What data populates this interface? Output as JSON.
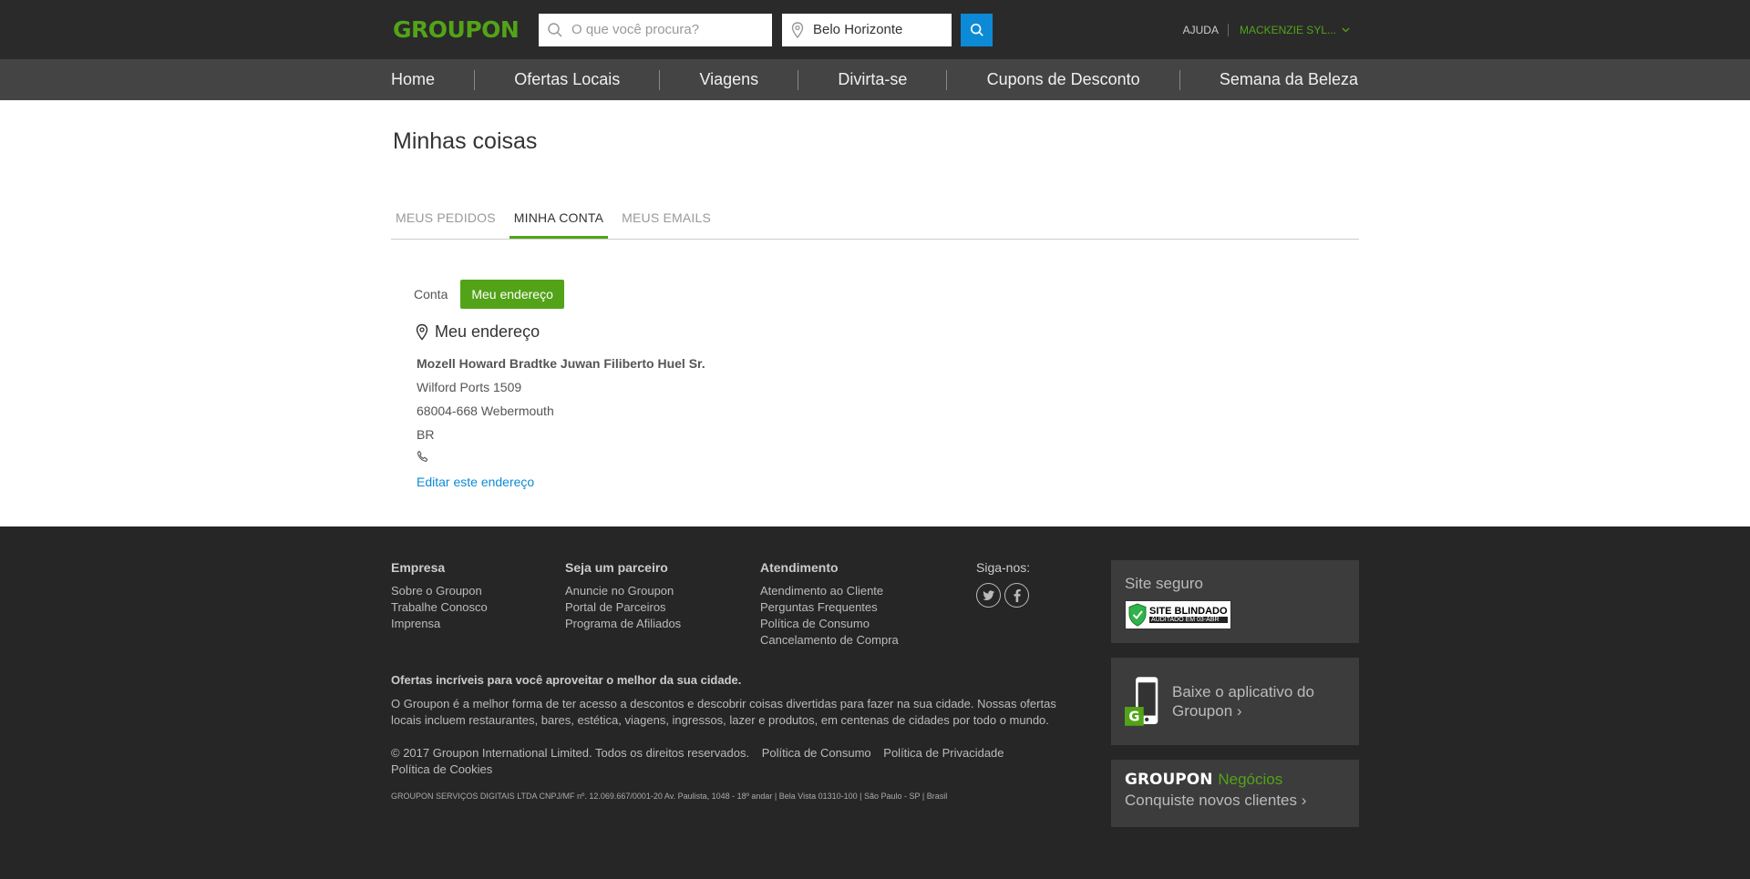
{
  "header": {
    "logo": "GROUPON",
    "search_placeholder": "O que você procura?",
    "location_value": "Belo Horizonte",
    "help": "AJUDA",
    "user": "MACKENZIE SYL..."
  },
  "nav": {
    "items": [
      "Home",
      "Ofertas Locais",
      "Viagens",
      "Divirta-se",
      "Cupons de Desconto",
      "Semana da Beleza"
    ]
  },
  "main": {
    "title": "Minhas coisas",
    "tabs": [
      "MEUS PEDIDOS",
      "MINHA CONTA",
      "MEUS EMAILS"
    ],
    "subtabs": [
      "Conta",
      "Meu endereço"
    ],
    "address_heading": "Meu endereço",
    "address": {
      "name": "Mozell Howard Bradtke Juwan Filiberto Huel Sr.",
      "street": "Wilford Ports 1509",
      "city": "68004-668 Webermouth",
      "country": "BR"
    },
    "edit_link": "Editar este endereço"
  },
  "footer": {
    "columns": [
      {
        "title": "Empresa",
        "links": [
          "Sobre o Groupon",
          "Trabalhe Conosco",
          "Imprensa"
        ]
      },
      {
        "title": "Seja um parceiro",
        "links": [
          "Anuncie no Groupon",
          "Portal de Parceiros",
          "Programa de Afiliados"
        ]
      },
      {
        "title": "Atendimento",
        "links": [
          "Atendimento ao Cliente",
          "Perguntas Frequentes",
          "Política de Consumo",
          "Cancelamento de Compra"
        ]
      }
    ],
    "follow": "Siga-nos:",
    "promo_title": "Ofertas incríveis para você aproveitar o melhor da sua cidade.",
    "promo_text": "O Groupon é a melhor forma de ter acesso a descontos e descobrir coisas divertidas para fazer na sua cidade. Nossas ofertas locais incluem restaurantes, bares, estética, viagens, ingressos, lazer e produtos, em centenas de cidades por todo o mundo.",
    "copyright": "© 2017 Groupon International Limited. Todos os direitos reservados.",
    "legal_links": [
      "Política de Consumo",
      "Política de Privacidade",
      "Política de Cookies"
    ],
    "cnpj": "GROUPON SERVIÇOS DIGITAIS LTDA CNPJ/MF nº. 12.069.667/0001-20 Av. Paulista, 1048 - 18º andar | Bela Vista 01310-100 | São Paulo - SP | Brasil",
    "secure_title": "Site seguro",
    "badge_line1": "SITE BLINDADO",
    "badge_line2": "AUDITADO EM 03-ABR",
    "app_text": "Baixe o aplicativo do Groupon ›",
    "biz_brand": "GROUPON",
    "biz_word": "Negócios",
    "biz_text": "Conquiste novos clientes ›"
  },
  "colors": {
    "brand_green": "#53a318",
    "link_blue": "#0d8ad6",
    "header_bg": "#2a2a2a",
    "nav_bg": "#444444",
    "footer_bg": "#262626"
  }
}
